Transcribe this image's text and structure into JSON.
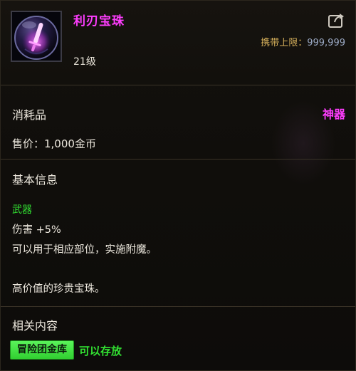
{
  "item": {
    "name": "利刃宝珠",
    "level": "21级",
    "icon": "orb-with-sword-icon",
    "carry_limit_label": "携带上限：",
    "carry_limit_value": "999,999",
    "category": "消耗品",
    "grade": "神器",
    "price": "售价：1,000金币"
  },
  "basic_info": {
    "title": "基本信息",
    "slot_tag": "武器",
    "effect": "伤害 +5%",
    "usage": "可以用于相应部位，实施附魔。",
    "flavor": "高价值的珍贵宝珠。"
  },
  "related": {
    "title": "相关内容",
    "guild_storage_button": "冒险团金库",
    "storable_text": "可以存放"
  },
  "colors": {
    "grade_color": "#ff3dff",
    "green_tag": "#32e332",
    "button_green": "#45e545",
    "carry_label": "#d8b25c",
    "carry_value": "#9ba9c4"
  }
}
